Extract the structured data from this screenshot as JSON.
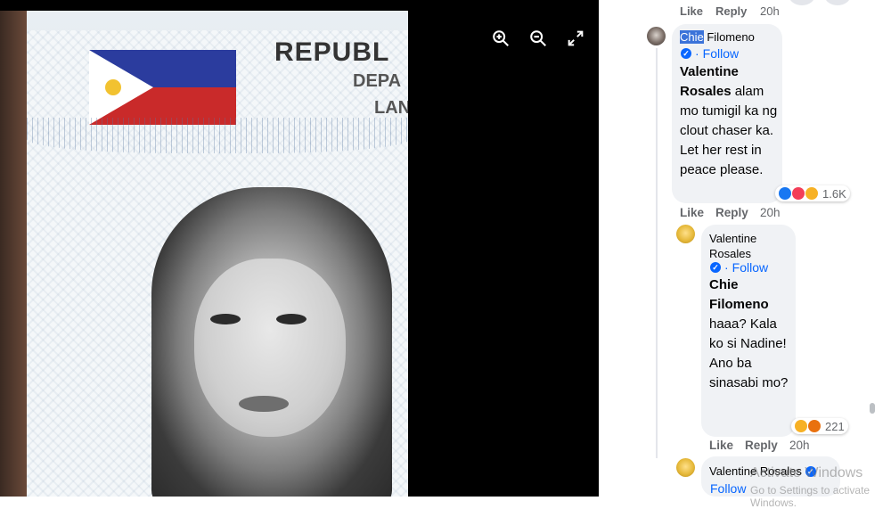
{
  "viewer": {
    "card_header": "REPUBL",
    "card_sub1": "DEPA",
    "card_sub2": "LAN",
    "zoom_in_icon": "zoom-in-icon",
    "zoom_out_icon": "zoom-out-icon",
    "expand_icon": "expand-icon"
  },
  "comments": [
    {
      "author_highlight": "Chie",
      "author_rest": " Filomeno",
      "follow": "Follow",
      "mention": "Valentine Rosales",
      "text": " alam mo tumigil ka ng clout chaser ka. Let her rest in peace please.",
      "reaction_count": "1.6K",
      "like": "Like",
      "reply": "Reply",
      "time": "20h"
    },
    {
      "author": "Valentine Rosales",
      "follow": "Follow",
      "mention": "Chie Filomeno",
      "text": " haaa? Kala ko si Nadine! Ano ba sinasabi mo?",
      "reaction_count": "221",
      "like": "Like",
      "reply": "Reply",
      "time": "20h"
    },
    {
      "author": "Valentine Rosales",
      "follow": "Follow"
    }
  ],
  "top_cut": {
    "like": "Like",
    "reply": "Reply",
    "time": "20h"
  },
  "watermark": {
    "line1": "Activate Windows",
    "line2": "Go to Settings to activate Windows."
  }
}
